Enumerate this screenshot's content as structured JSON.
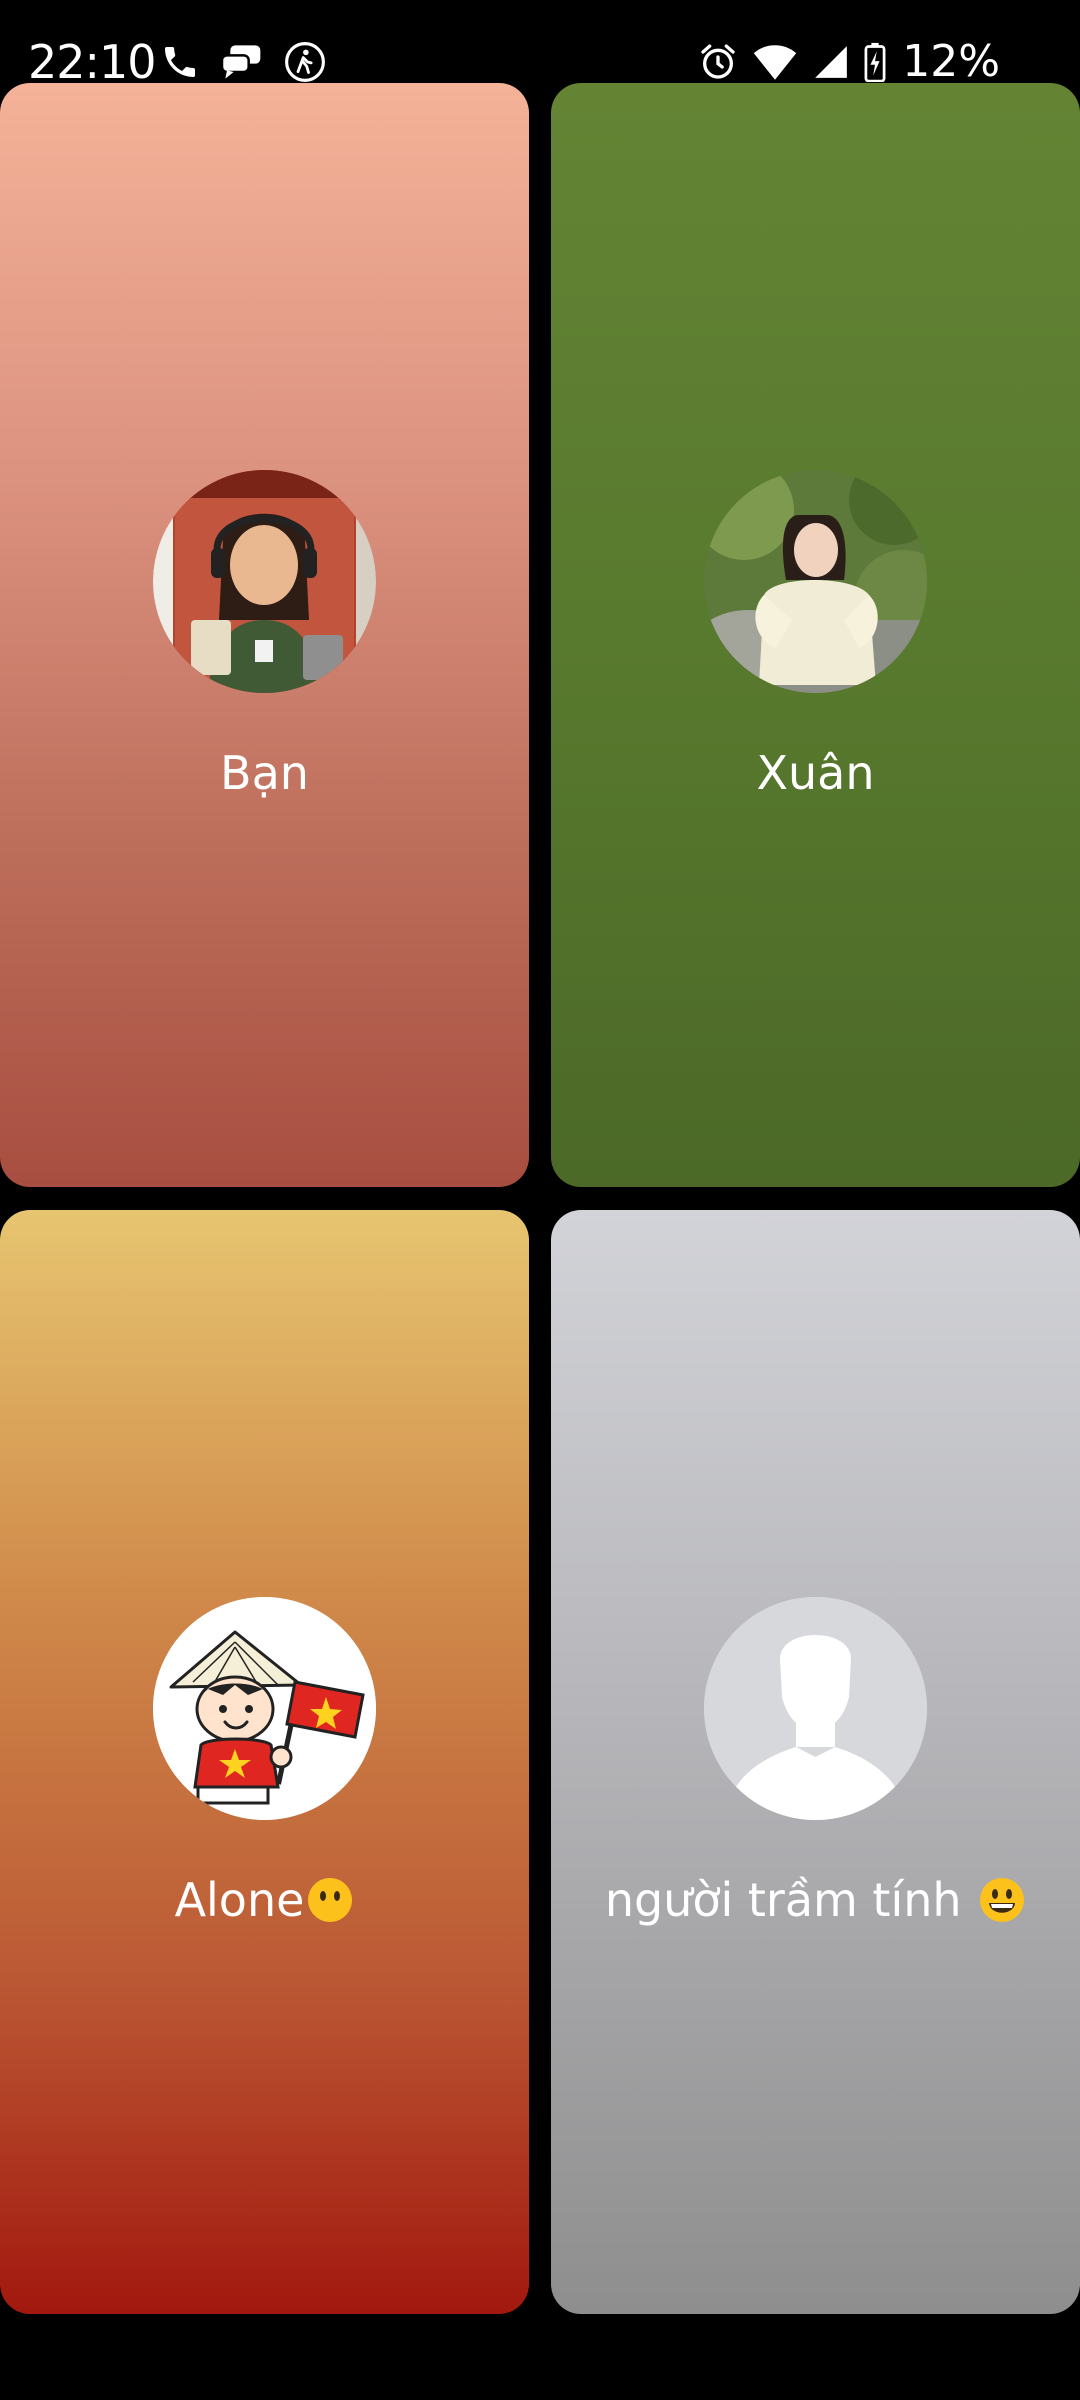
{
  "status_bar": {
    "time": "22:10",
    "left_icons": [
      "phone-icon",
      "chat-bubbles-icon",
      "accessibility-icon"
    ],
    "right_icons": [
      "alarm-icon",
      "wifi-icon",
      "signal-icon",
      "battery-charging-icon"
    ],
    "battery_percent": "12%"
  },
  "participants": [
    {
      "name": "Bạn",
      "avatar": "avatar-photo-girl-uniform",
      "color": "#dc9380"
    },
    {
      "name": "Xuân",
      "avatar": "avatar-photo-woman-outdoor",
      "color": "#587a2e"
    },
    {
      "name": "Alone",
      "emoji": "neutral-face-emoji",
      "avatar": "avatar-cartoon-boy-flag",
      "color": "#c86c40"
    },
    {
      "name": "người trầm tính",
      "emoji": "grinning-face-emoji",
      "avatar": "avatar-default-silhouette",
      "color": "#b0b0b4"
    }
  ]
}
